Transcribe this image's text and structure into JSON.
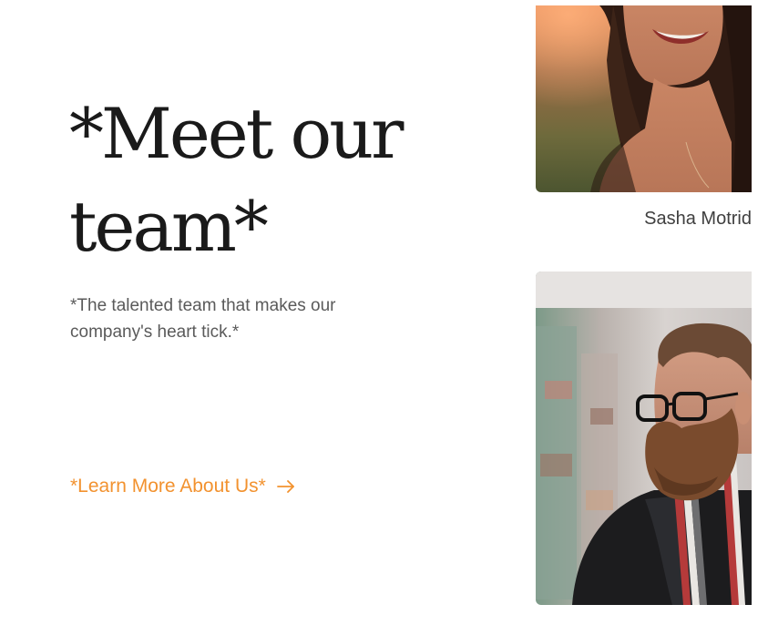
{
  "hero": {
    "title_line1": "*Meet our",
    "title_line2": "team*",
    "subtitle": "*The talented team that makes our company's heart tick.*",
    "cta_label": "*Learn More About Us*",
    "cta_icon": "arrow-right-icon",
    "accent_color": "#f2922f"
  },
  "team": [
    {
      "name": "Sasha Motrid",
      "photo": "smiling-woman-photo"
    },
    {
      "photo": "bearded-man-photo"
    }
  ]
}
